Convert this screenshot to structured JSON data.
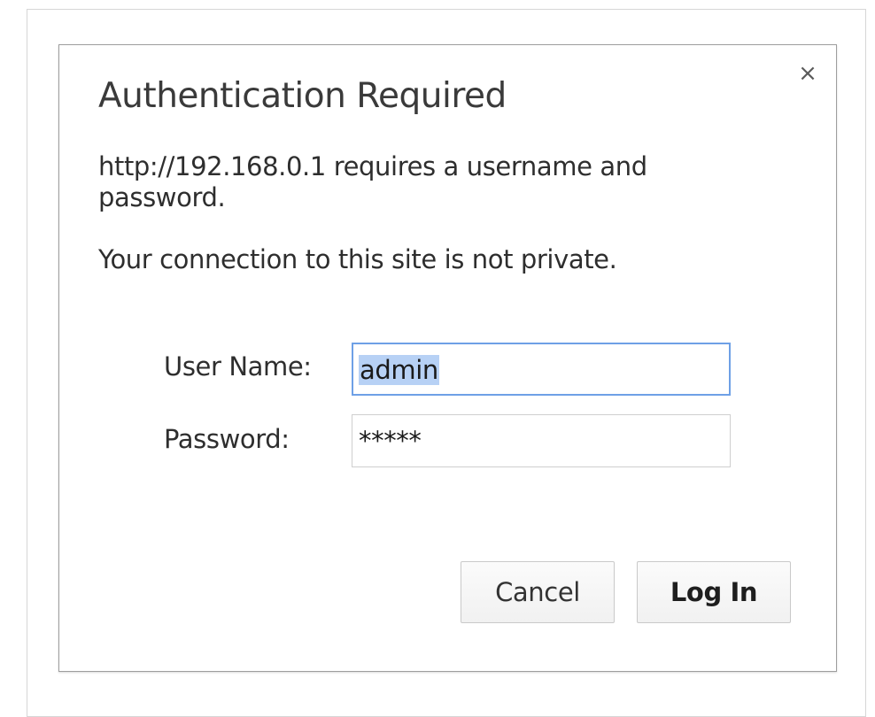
{
  "dialog": {
    "close_glyph": "×",
    "title": "Authentication Required",
    "message": "http://192.168.0.1 requires a username and password.",
    "privacy_notice": "Your connection to this site is not private.",
    "username_label": "User Name:",
    "username_value": "admin",
    "password_label": "Password:",
    "password_masked": "*****",
    "cancel_label": "Cancel",
    "login_label": "Log In"
  },
  "colors": {
    "focus_border": "#6ea0e6",
    "selection_highlight": "#b7d1f5"
  }
}
